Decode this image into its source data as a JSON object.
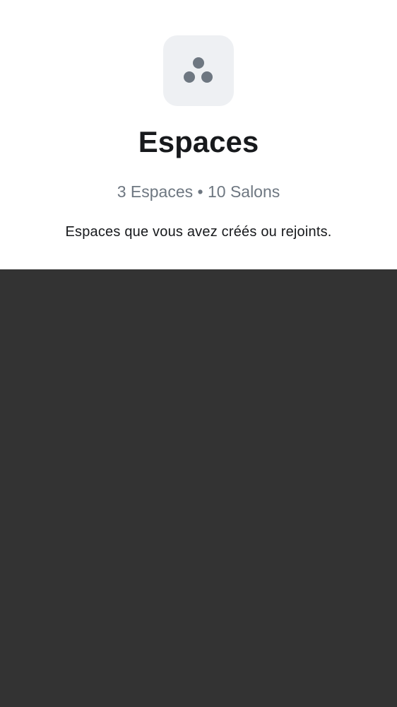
{
  "sheet": {
    "icon": "spaces-icon",
    "title": "Espaces",
    "summary": {
      "spaces_count": "3 Espaces",
      "separator": "•",
      "rooms_count": "10 Salons"
    },
    "description": "Espaces que vous avez créés ou rejoints."
  },
  "colors": {
    "sheet_background": "#ffffff",
    "backdrop": "#333333",
    "icon_tile": "#eef0f3",
    "icon_dots": "#6e7781",
    "title_text": "#17191c",
    "secondary_text": "#6e7781"
  }
}
